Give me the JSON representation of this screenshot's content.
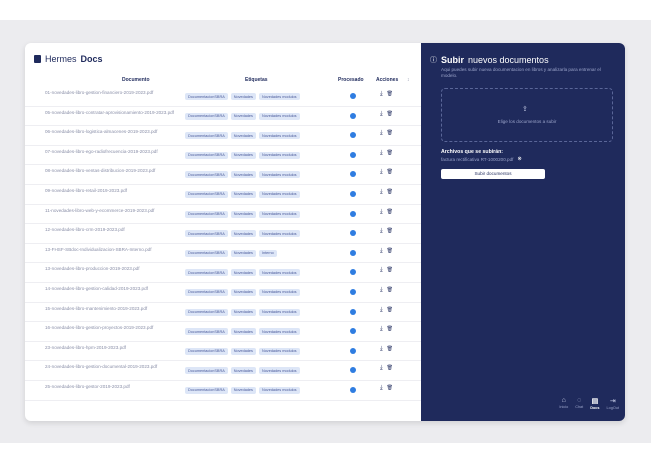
{
  "app": {
    "name_prefix": "Hermes",
    "name_bold": "Docs"
  },
  "table": {
    "headers": {
      "documento": "Documento",
      "etiquetas": "Etiquetas",
      "procesado": "Procesado",
      "acciones": "Acciones"
    },
    "rows": [
      {
        "doc": "01-novedades-libro-gestion-financiero-2019-2023.pdf",
        "tags": [
          "DocumentacionSBRA",
          "Novedades",
          "Novedades modulos"
        ]
      },
      {
        "doc": "05-novedades-libro-contratar-aprovisionamiento-2019-2023.pdf",
        "tags": [
          "DocumentacionSBRA",
          "Novedades",
          "Novedades modulos"
        ]
      },
      {
        "doc": "06-novedades-libro-logistica-almacenes-2019-2023.pdf",
        "tags": [
          "DocumentacionSBRA",
          "Novedades",
          "Novedades modulos"
        ]
      },
      {
        "doc": "07-novedades-libro-ego-radiofrecuencia-2019-2023.pdf",
        "tags": [
          "DocumentacionSBRA",
          "Novedades",
          "Novedades modulos"
        ]
      },
      {
        "doc": "08-novedades-libro-ventas-distribucion-2019-2023.pdf",
        "tags": [
          "DocumentacionSBRA",
          "Novedades",
          "Novedades modulos"
        ]
      },
      {
        "doc": "09-novedades-libro-retail-2019-2023.pdf",
        "tags": [
          "DocumentacionSBRA",
          "Novedades",
          "Novedades modulos"
        ]
      },
      {
        "doc": "11-novedades-libro-web-y-ecommerce-2019-2023.pdf",
        "tags": [
          "DocumentacionSBRA",
          "Novedades",
          "Novedades modulos"
        ]
      },
      {
        "doc": "12-novedades-libro-crm-2019-2023.pdf",
        "tags": [
          "DocumentacionSBRA",
          "Novedades",
          "Novedades modulos"
        ]
      },
      {
        "doc": "13-FHSF-SBdoc-Individualizacion-SBRA-Interno.pdf",
        "tags": [
          "DocumentacionSBRA",
          "Novedades",
          "Interno"
        ]
      },
      {
        "doc": "13-novedades-libro-produccion-2019-2023.pdf",
        "tags": [
          "DocumentacionSBRA",
          "Novedades",
          "Novedades modulos"
        ]
      },
      {
        "doc": "14-novedades-libro-gestion-calidad-2019-2023.pdf",
        "tags": [
          "DocumentacionSBRA",
          "Novedades",
          "Novedades modulos"
        ]
      },
      {
        "doc": "15-novedades-libro-mantenimiento-2019-2023.pdf",
        "tags": [
          "DocumentacionSBRA",
          "Novedades",
          "Novedades modulos"
        ]
      },
      {
        "doc": "16-novedades-libro-gestion-proyectos-2019-2023.pdf",
        "tags": [
          "DocumentacionSBRA",
          "Novedades",
          "Novedades modulos"
        ]
      },
      {
        "doc": "23-novedades-libro-hpm-2019-2023.pdf",
        "tags": [
          "DocumentacionSBRA",
          "Novedades",
          "Novedades modulos"
        ]
      },
      {
        "doc": "24-novedades-libro-gestion-documental-2019-2023.pdf",
        "tags": [
          "DocumentacionSBRA",
          "Novedades",
          "Novedades modulos"
        ]
      },
      {
        "doc": "25-novedades-libro-gestor-2019-2023.pdf",
        "tags": [
          "DocumentacionSBRA",
          "Novedades",
          "Novedades modulos"
        ]
      }
    ],
    "action_icons": [
      "download-icon",
      "trash-icon"
    ]
  },
  "upload": {
    "title_bold": "Subir",
    "title_rest": "nuevos documentos",
    "subtitle": "Aqui puedes subir nueva documentacion en libros y analizarla para entrenar el modelo.",
    "drop_text": "Elige los documentos a subir",
    "pending_title": "Archivos que se subirán:",
    "pending_file": "factura rectificativa RT-1000200.pdf",
    "button": "Subir documentos"
  },
  "nav": [
    {
      "label": "Inicio",
      "icon": "home-icon"
    },
    {
      "label": "Chat",
      "icon": "chat-icon"
    },
    {
      "label": "Docs",
      "icon": "docs-icon",
      "active": true
    },
    {
      "label": "LogOut",
      "icon": "logout-icon"
    }
  ],
  "colors": {
    "primary": "#1f2a5c",
    "accent": "#2f7de1",
    "tag_bg": "#dde6f7"
  }
}
